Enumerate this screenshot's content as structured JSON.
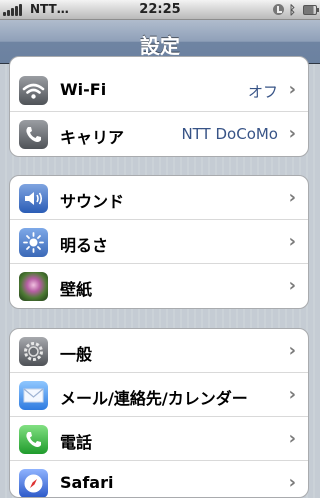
{
  "status": {
    "carrier": "NTT…",
    "time": "22:25"
  },
  "nav": {
    "title": "設定"
  },
  "groups": [
    [
      {
        "label": "Wi-Fi",
        "value": "オフ",
        "icon": "wifi-icon"
      },
      {
        "label": "キャリア",
        "value": "NTT DoCoMo",
        "icon": "phone-icon"
      }
    ],
    [
      {
        "label": "サウンド",
        "icon": "speaker-icon"
      },
      {
        "label": "明るさ",
        "icon": "brightness-icon"
      },
      {
        "label": "壁紙",
        "icon": "wallpaper-icon"
      }
    ],
    [
      {
        "label": "一般",
        "icon": "gear-icon"
      },
      {
        "label": "メール/連絡先/カレンダー",
        "icon": "mail-icon"
      },
      {
        "label": "電話",
        "icon": "phone-icon"
      },
      {
        "label": "Safari",
        "icon": "compass-icon"
      }
    ]
  ],
  "chevron": "›"
}
